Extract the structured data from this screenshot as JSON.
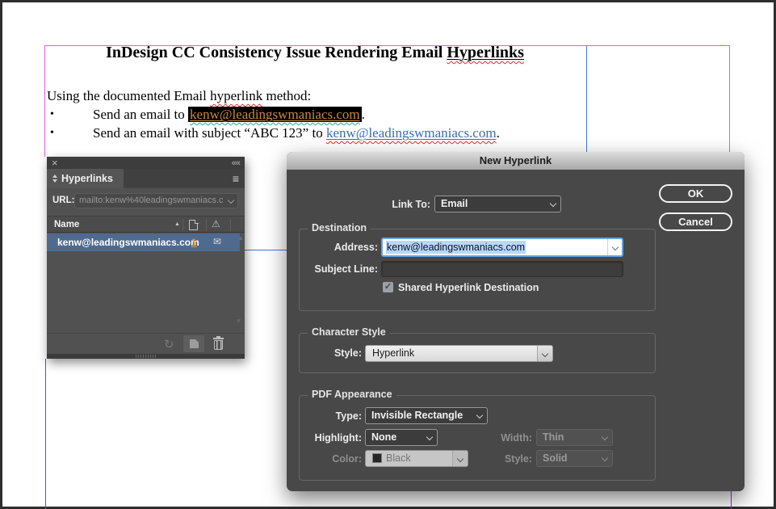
{
  "colors": {
    "frame_pink": "#ee55ee",
    "guide_purple": "#8d2fe0",
    "frame_blue": "#3f7ad1",
    "selected_row_blue": "#4e6a8e",
    "count_orange": "#e8952f",
    "doc_link_gold": "#c9873b",
    "doc_link_blue": "#3a6db5",
    "dialog_bg": "#484848",
    "panel_bg": "#515151"
  },
  "icons": {
    "close": "×",
    "collapse_panel": "««",
    "panel_menu": "≡",
    "sort_ascending": "▲",
    "warning": "⚠",
    "envelope": "✉",
    "refresh": "↻",
    "bullet": "•",
    "check": "✓",
    "scroll_up": "▲",
    "scroll_down": "▼"
  },
  "document": {
    "title_prefix": "InDesign CC Consistency Issue Rendering Email ",
    "title_link_word": "Hyperlinks",
    "intro_prefix": "Using the documented Email ",
    "intro_wavy_word": "hyperlink",
    "intro_suffix": " method:",
    "bullet1_prefix": "Send an email to ",
    "bullet1_link": "kenw@leadingswmaniacs.com",
    "bullet1_suffix": ".",
    "bullet2_prefix": "Send an email with subject “ABC 123” to ",
    "bullet2_link": "kenw@leadingswmaniacs.com",
    "bullet2_suffix": "."
  },
  "panel": {
    "tab_title": "Hyperlinks",
    "url_label": "URL:",
    "url_value": "mailto:kenw%40leadingswmaniacs.c",
    "name_header": "Name",
    "row": {
      "name": "kenw@leadingswmaniacs.com",
      "count": "1"
    }
  },
  "dialog": {
    "title": "New Hyperlink",
    "link_to_label": "Link To:",
    "link_to_value": "Email",
    "ok_label": "OK",
    "cancel_label": "Cancel",
    "destination": {
      "legend": "Destination",
      "address_label": "Address:",
      "address_value": "kenw@leadingswmaniacs.com",
      "subject_label": "Subject Line:",
      "subject_value": "",
      "checkbox_label": "Shared Hyperlink Destination"
    },
    "character_style": {
      "legend": "Character Style",
      "style_label": "Style:",
      "style_value": "Hyperlink"
    },
    "pdf_appearance": {
      "legend": "PDF Appearance",
      "type_label": "Type:",
      "type_value": "Invisible Rectangle",
      "highlight_label": "Highlight:",
      "highlight_value": "None",
      "width_label": "Width:",
      "width_value": "Thin",
      "color_label": "Color:",
      "color_value": "Black",
      "style_label": "Style:",
      "style_value": "Solid"
    }
  }
}
